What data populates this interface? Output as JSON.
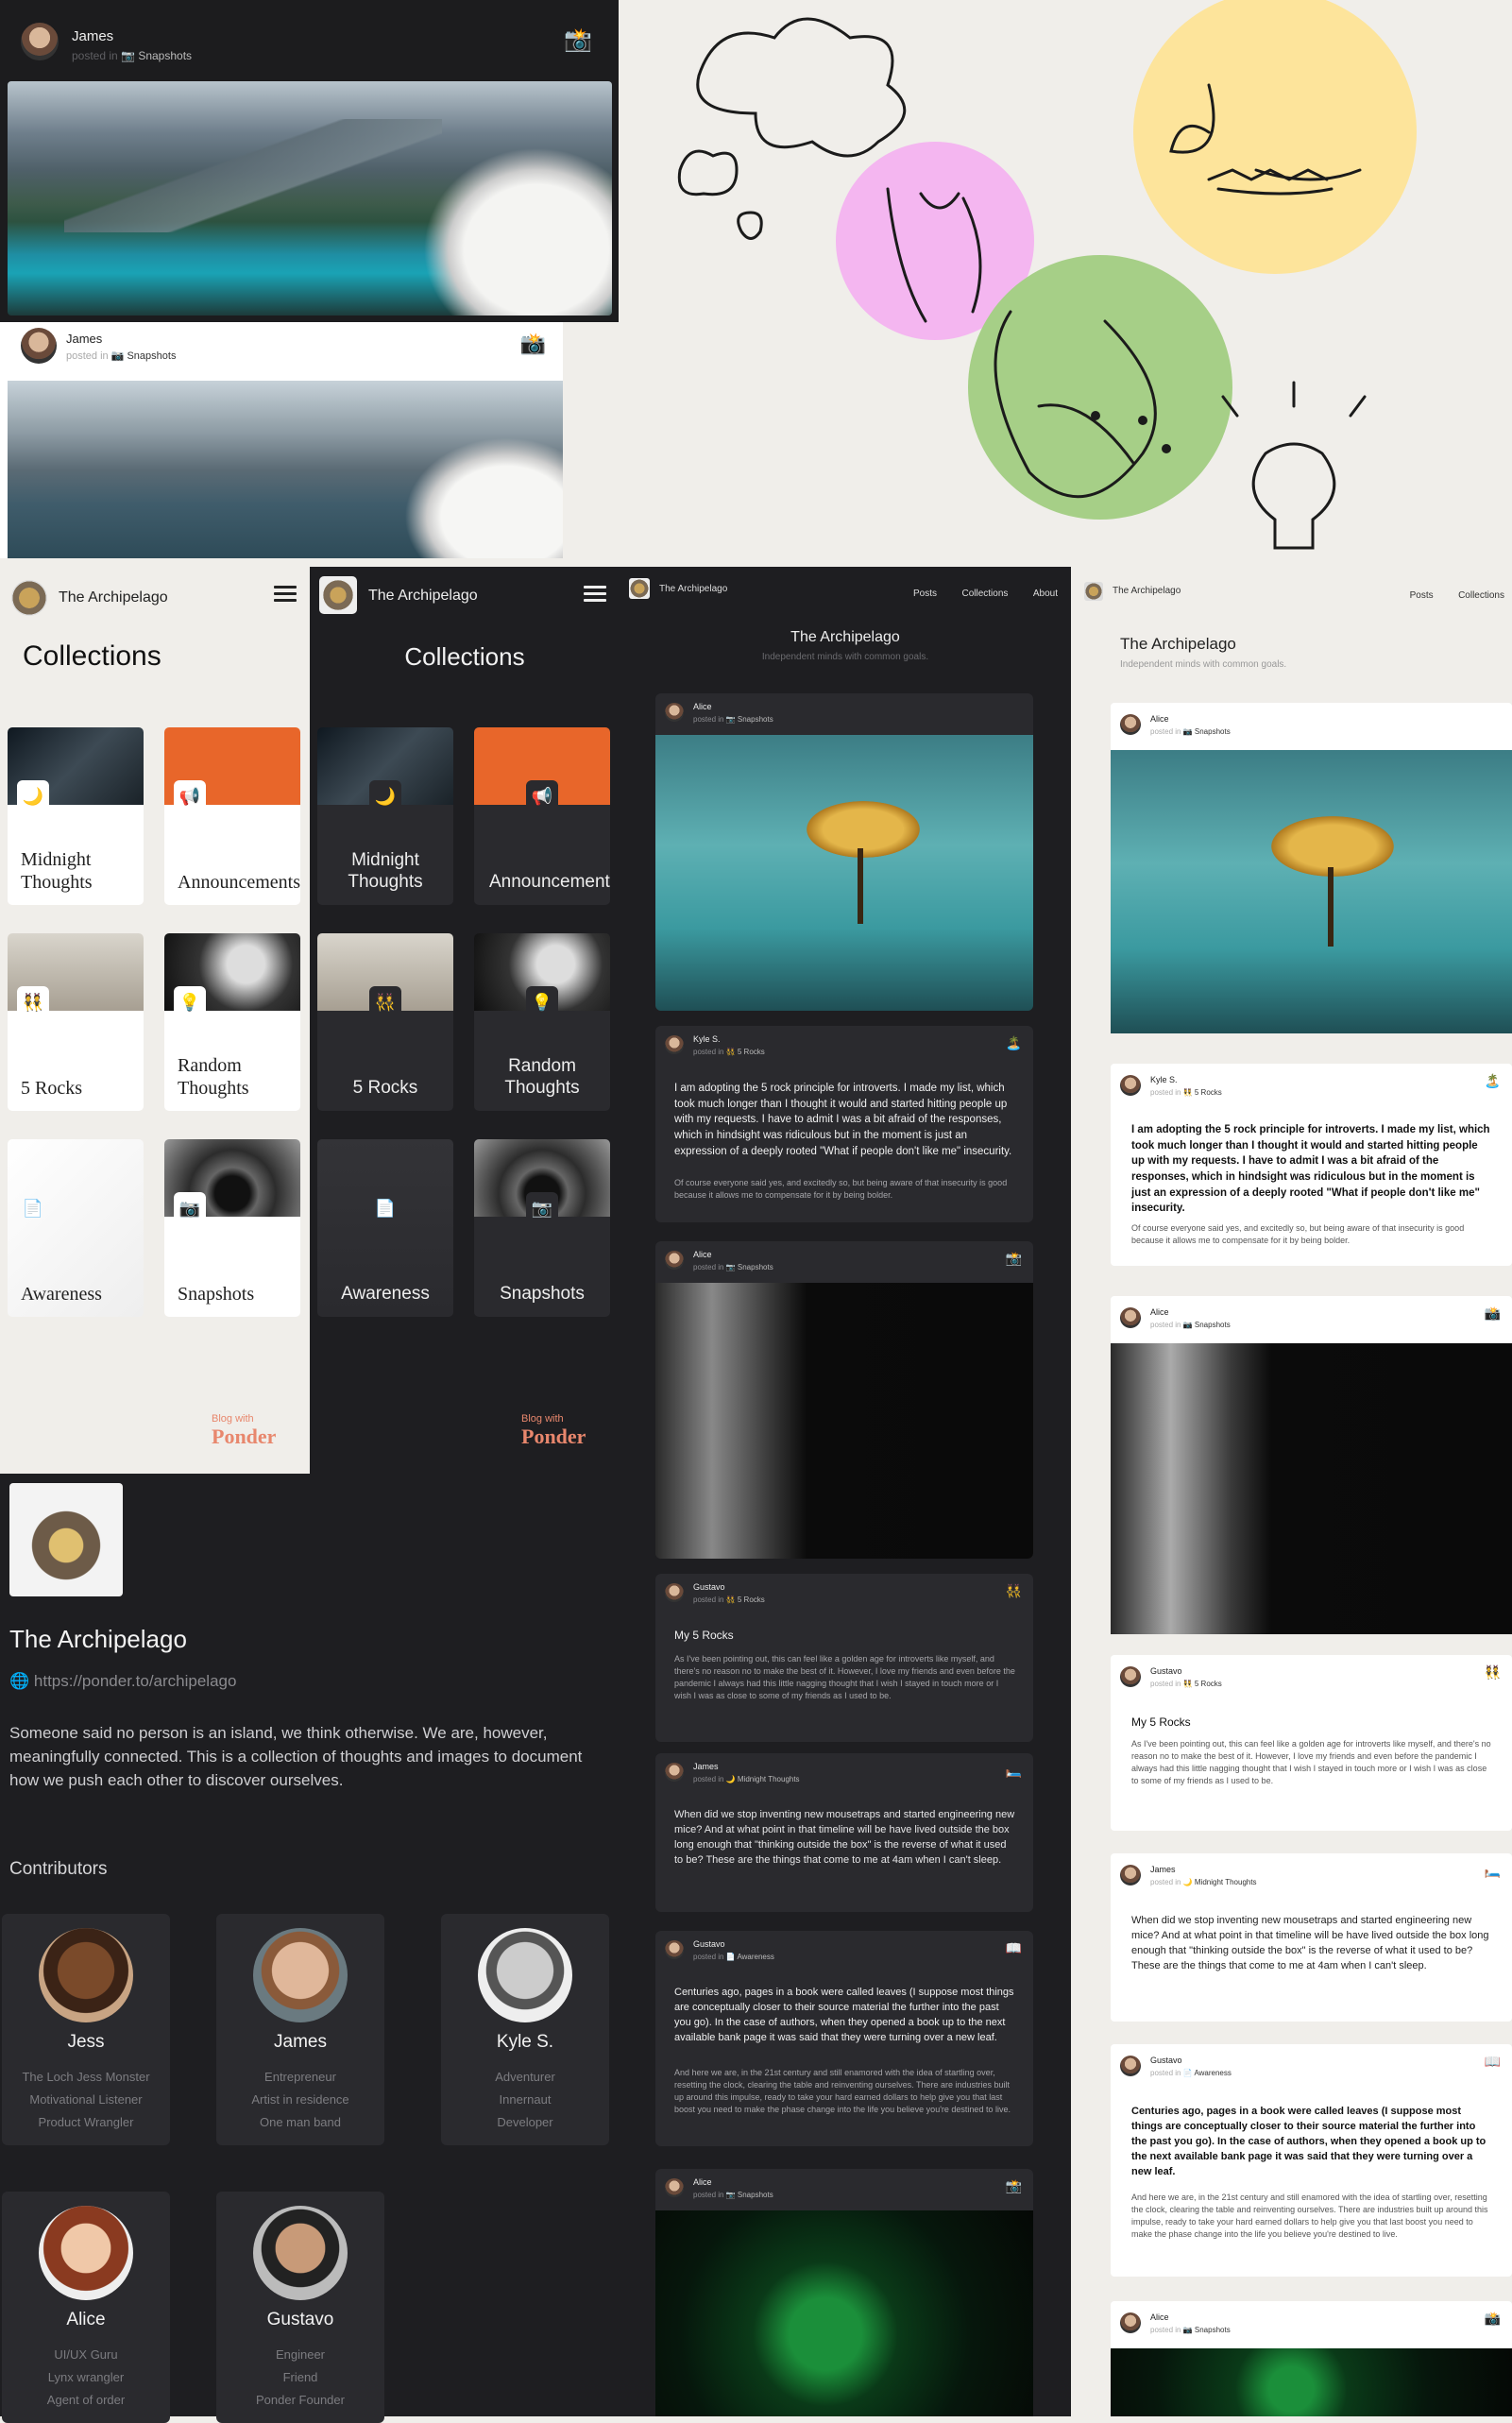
{
  "top_card_dark": {
    "author": "James",
    "posted_prefix": "posted in",
    "collection": "📷 Snapshots",
    "icon": "📸"
  },
  "top_card_light": {
    "author": "James",
    "posted_prefix": "posted in",
    "collection": "📷 Snapshots",
    "icon": "📸"
  },
  "blog": {
    "name": "The Archipelago",
    "tagline": "Independent minds with common goals.",
    "url": "https://ponder.to/archipelago",
    "description": "Someone said no person is an island, we think otherwise. We are, however, meaningfully connected. This is a collection of thoughts and images to document how we push each other to discover ourselves."
  },
  "nav": {
    "posts": "Posts",
    "collections": "Collections",
    "about": "About"
  },
  "collections_page": {
    "title": "Collections",
    "footer_small": "Blog with",
    "footer_brand": "Ponder"
  },
  "collections": [
    {
      "name": "Midnight\nThoughts",
      "icon": "🌙"
    },
    {
      "name": "Announcements",
      "icon": "📢"
    },
    {
      "name": "5 Rocks",
      "icon": "👯"
    },
    {
      "name": "Random\nThoughts",
      "icon": "💡"
    },
    {
      "name": "Awareness",
      "icon": "📄"
    },
    {
      "name": "Snapshots",
      "icon": "📷"
    }
  ],
  "contributors_heading": "Contributors",
  "contributors": [
    {
      "name": "Jess",
      "lines": [
        "The Loch Jess Monster",
        "Motivational Listener",
        "Product Wrangler"
      ]
    },
    {
      "name": "James",
      "lines": [
        "Entrepreneur",
        "Artist in residence",
        "One man band"
      ]
    },
    {
      "name": "Kyle S.",
      "lines": [
        "Adventurer",
        "Innernaut",
        "Developer"
      ]
    },
    {
      "name": "Alice",
      "lines": [
        "UI/UX Guru",
        "Lynx wrangler",
        "Agent of order"
      ]
    },
    {
      "name": "Gustavo",
      "lines": [
        "Engineer",
        "Friend",
        "Ponder Founder"
      ]
    }
  ],
  "posts": {
    "p1": {
      "author": "Alice",
      "collection": "📷 Snapshots"
    },
    "p2": {
      "author": "Kyle S.",
      "collection": "👯 5 Rocks",
      "icon": "🏝️",
      "bold": "I am adopting the 5 rock principle for introverts. I made my list, which took much longer than I thought it would and started hitting people up with my requests. I have to admit I was a bit afraid of the responses, which in hindsight was ridiculous but in the moment is just an expression of a deeply rooted \"What if people don't like me\" insecurity.",
      "body": "Of course everyone said yes, and excitedly so, but being aware of that insecurity is good because it allows me to compensate for it by being bolder."
    },
    "p3": {
      "author": "Alice",
      "collection": "📷 Snapshots",
      "icon": "📸"
    },
    "p4": {
      "author": "Gustavo",
      "collection": "👯 5 Rocks",
      "icon": "👯",
      "title": "My 5 Rocks",
      "body": "As I've been pointing out, this can feel like a golden age for introverts like myself, and there's no reason no to make the best of it. However, I love my friends and even before the pandemic I always had this little nagging thought that I wish I stayed in touch more or I wish I was as close to some of my friends as I used to be."
    },
    "p5": {
      "author": "James",
      "collection": "🌙 Midnight Thoughts",
      "icon": "🛏️",
      "body": "When did we stop inventing new mousetraps and started engineering new mice? And at what point in that timeline will be have lived outside the box long enough that \"thinking outside the box\" is the reverse of what it used to be? These are the things that come to me at 4am when I can't sleep."
    },
    "p6": {
      "author": "Gustavo",
      "collection": "📄 Awareness",
      "icon": "📖",
      "bold": "Centuries ago, pages in a book were called leaves (I suppose most things are conceptually closer to their source material the further into the past you go). In the case of authors, when they opened a book up to the next available bank page it was said that they were turning over a new leaf.",
      "body": "And here we are, in the 21st century and still enamored with the idea of startling over, resetting the clock, clearing the table and reinventing ourselves. There are industries built up around this impulse, ready to take your hard earned dollars to help give you that last boost you need to make the phase change into the life you believe you're destined to live."
    },
    "p7": {
      "author": "Alice",
      "collection": "📷 Snapshots",
      "icon": "📸"
    }
  },
  "posted_in": "posted in"
}
